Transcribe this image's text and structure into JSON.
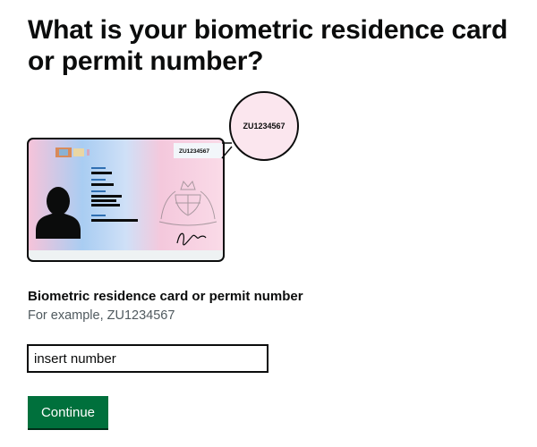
{
  "page": {
    "heading": "What is your biometric residence card or permit number?"
  },
  "illustration": {
    "card_number": "ZU1234567",
    "zoom_number": "ZU1234567"
  },
  "form": {
    "label": "Biometric residence card or permit number",
    "hint": "For example, ZU1234567",
    "input_placeholder": "insert number"
  },
  "actions": {
    "continue_label": "Continue"
  },
  "colors": {
    "button": "#00703c",
    "text": "#0b0c0c",
    "hint": "#505a5f"
  }
}
